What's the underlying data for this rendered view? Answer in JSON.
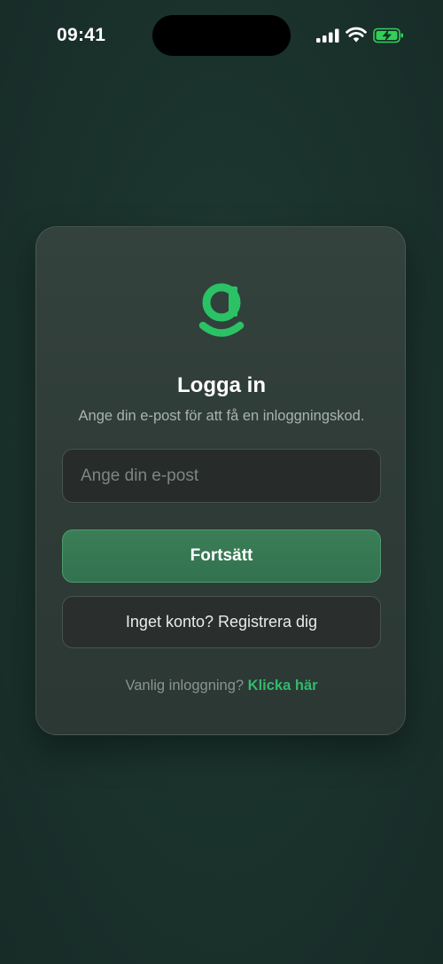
{
  "status_bar": {
    "time": "09:41"
  },
  "login": {
    "title": "Logga in",
    "subtitle": "Ange din e-post för att få en inloggningskod.",
    "email_placeholder": "Ange din e-post",
    "email_value": "",
    "continue_label": "Fortsätt",
    "register_label": "Inget konto? Registrera dig",
    "legacy_prompt": "Vanlig inloggning?",
    "legacy_link": "Klicka här"
  },
  "icons": {
    "signal": "cellular-signal-icon",
    "wifi": "wifi-icon",
    "battery": "battery-charging-icon",
    "logo": "brand-g-logo"
  },
  "colors": {
    "background": "#1b332d",
    "card": "#2e3b37",
    "accent_green": "#35b86c",
    "button_green": "#3a7e57",
    "battery_green": "#30d158"
  }
}
